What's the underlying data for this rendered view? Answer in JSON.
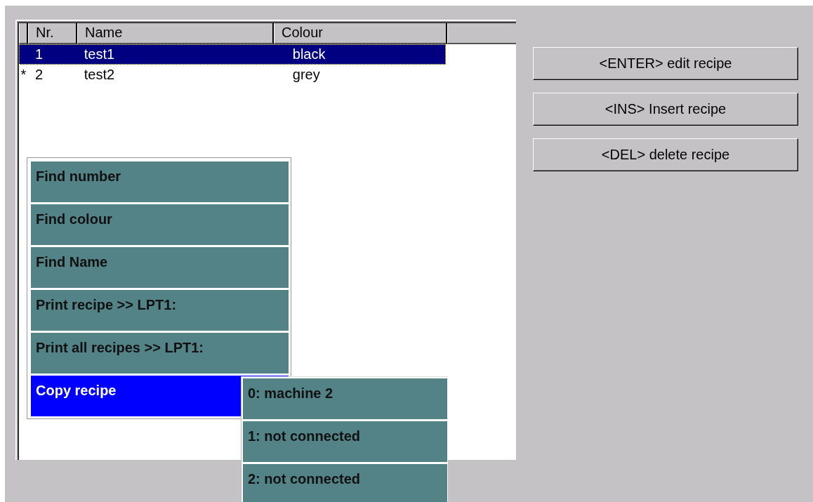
{
  "table": {
    "columns": [
      {
        "label": "Nr."
      },
      {
        "label": "Name"
      },
      {
        "label": "Colour"
      }
    ],
    "rows": [
      {
        "marker": "",
        "nr": "1",
        "name": "test1",
        "colour": "black",
        "selected": true
      },
      {
        "marker": "*",
        "nr": "2",
        "name": "test2",
        "colour": "grey",
        "selected": false
      }
    ]
  },
  "buttons": [
    "<ENTER> edit recipe",
    "<INS> Insert recipe",
    "<DEL> delete recipe"
  ],
  "context_menu": {
    "items": [
      {
        "label": "Find number",
        "selected": false
      },
      {
        "label": "Find colour",
        "selected": false
      },
      {
        "label": "Find Name",
        "selected": false
      },
      {
        "label": "Print recipe >> LPT1:",
        "selected": false
      },
      {
        "label": "Print all recipes >> LPT1:",
        "selected": false
      },
      {
        "label": "Copy recipe",
        "selected": true
      }
    ]
  },
  "submenu": {
    "items": [
      {
        "label": "0: machine 2",
        "selected": false
      },
      {
        "label": "1: not connected",
        "selected": false
      },
      {
        "label": "2: not connected",
        "selected": false
      }
    ]
  }
}
